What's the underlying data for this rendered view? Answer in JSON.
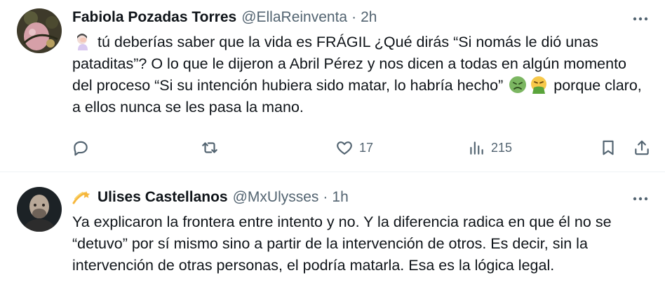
{
  "tweets": [
    {
      "author_name": "Fabiola Pozadas Torres",
      "handle": "@EllaReinventa",
      "separator": "·",
      "time": "2h",
      "text_part1": " tú deberías saber que la vida es FRÁGIL ¿Qué dirás “Si nomás le dió unas pataditas”? O lo que le dijeron a Abril Pérez y nos dicen a todas en algún momento del proceso “Si su intención hubiera sido matar, lo habría hecho” ",
      "text_part2": " porque claro, a ellos nunca se les pasa la mano.",
      "emojis": [
        "face-palm-emoji",
        "nauseated-face-emoji",
        "vomiting-face-emoji"
      ],
      "likes": "17",
      "views": "215"
    },
    {
      "author_name": "Ulises Castellanos",
      "handle": "@MxUlysses",
      "separator": "·",
      "time": "1h",
      "badge_icon": "shooting-star-emoji",
      "text": "Ya explicaron la frontera entre intento y no. Y la diferencia radica en que él no se “detuvo” por sí mismo sino a partir de la intervención de otros. Es decir, sin la intervención de otras personas, el podría matarla. Esa es la lógica legal."
    }
  ],
  "icons": {
    "more": "more-dots-icon",
    "reply": "reply-icon",
    "retweet": "retweet-icon",
    "like": "heart-icon",
    "views": "views-chart-icon",
    "bookmark": "bookmark-icon",
    "share": "share-icon"
  },
  "colors": {
    "text": "#0f1419",
    "secondary": "#536471",
    "divider": "#eff3f4"
  }
}
